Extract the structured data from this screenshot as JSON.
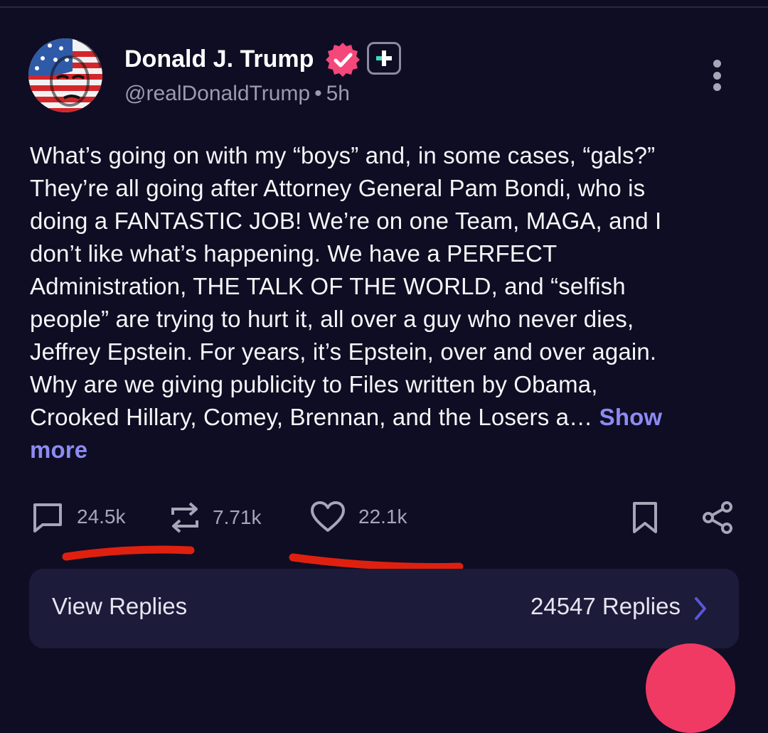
{
  "post": {
    "display_name": "Donald J. Trump",
    "handle": "@realDonaldTrump",
    "separator": "•",
    "time_ago": "5h",
    "text_lines": [
      "What’s going on with my “boys” and, in some cases, “gals?”",
      "They’re all going after Attorney General Pam Bondi, who is",
      "doing a FANTASTIC JOB! We’re on one Team, MAGA, and I",
      "don’t like what’s happening. We have a PERFECT",
      "Administration, THE TALK OF THE WORLD, and “selfish",
      "people” are trying to hurt it, all over a guy who never dies,",
      "Jeffrey Epstein. For years, it’s Epstein, over and over again.",
      "Why are we giving publicity to Files written by Obama,",
      "Crooked Hillary, Comey, Brennan, and the Losers a…"
    ],
    "show_more_part1": "Show",
    "show_more_part2": "more"
  },
  "actions": {
    "replies": "24.5k",
    "reposts": "7.71k",
    "likes": "22.1k"
  },
  "view_replies": {
    "label": "View Replies",
    "count_label": "24547 Replies"
  },
  "icons": [
    "verified-badge-icon",
    "plus-badge-icon",
    "more-vertical-icon",
    "reply-icon",
    "repost-icon",
    "heart-icon",
    "bookmark-icon",
    "share-icon",
    "chevron-right-icon"
  ],
  "colors": {
    "background": "#0e0d23",
    "accent": "#8d8bf2",
    "verified": "#f4477a",
    "annotation": "#e0200f",
    "replies_card": "#1c1b3a"
  }
}
